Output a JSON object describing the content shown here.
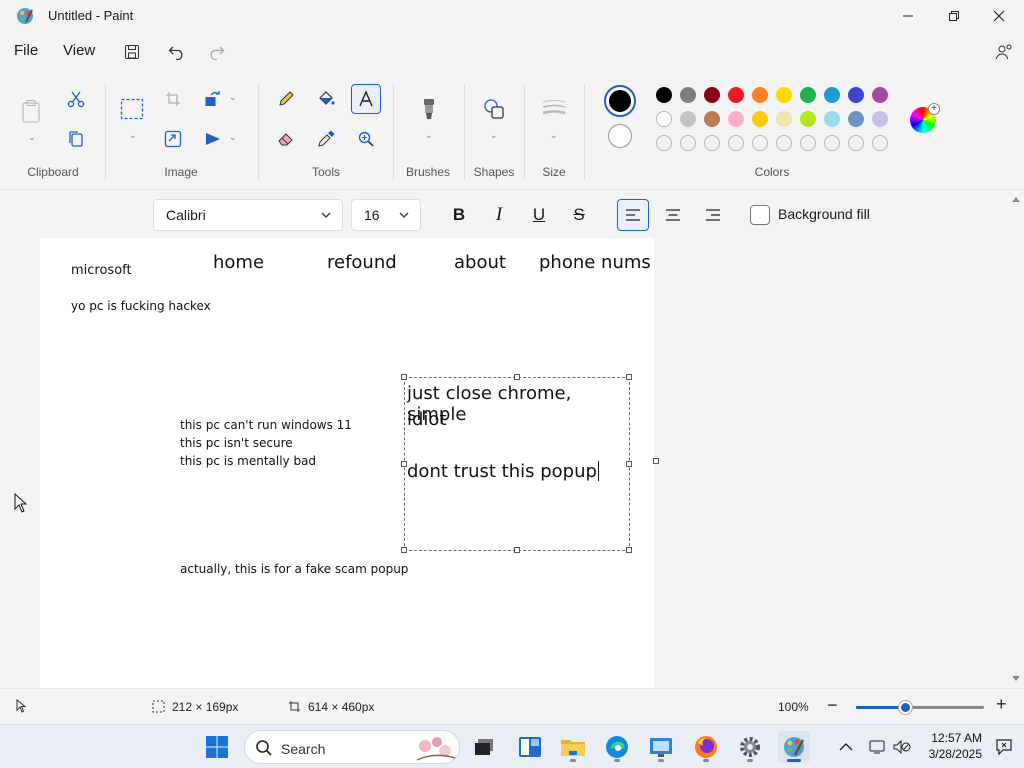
{
  "window": {
    "title": "Untitled - Paint"
  },
  "menu": {
    "file": "File",
    "view": "View"
  },
  "ribbon": {
    "groups": {
      "clipboard": "Clipboard",
      "image": "Image",
      "tools": "Tools",
      "brushes": "Brushes",
      "shapes": "Shapes",
      "size": "Size",
      "colors": "Colors"
    },
    "colors": {
      "primary": "#000000",
      "secondary": "#ffffff",
      "row1": [
        "#000000",
        "#7f7f7f",
        "#880015",
        "#ed1c24",
        "#ff7f27",
        "#ffd800",
        "#22b14c",
        "#1d9bd7",
        "#3f48cc",
        "#a349a4"
      ],
      "row2": [
        "#ffffff",
        "#c3c3c3",
        "#b97a57",
        "#ffaec9",
        "#ffc90e",
        "#efe4b0",
        "#b5e61d",
        "#99d9ea",
        "#7092be",
        "#c8bfe7"
      ]
    }
  },
  "text_toolbar": {
    "font": "Calibri",
    "size": "16",
    "background_fill": "Background fill"
  },
  "canvas": {
    "brand": "microsoft",
    "nav": [
      "home",
      "refound",
      "about",
      "phone nums"
    ],
    "warning": "yo pc is fucking hackex",
    "checks": [
      "this pc can't run windows 11",
      "this pc isn't secure",
      "this pc is mentally bad"
    ],
    "footer": "actually, this is for a fake scam popup",
    "textbox_lines": [
      "just close chrome, simple",
      "idiot",
      "dont trust this popup"
    ]
  },
  "status": {
    "selection": "212 × 169px",
    "canvas_size": "614 × 460px",
    "zoom": "100%",
    "zoom_level": 0.38
  },
  "taskbar": {
    "search": "Search",
    "time": "12:57 AM",
    "date": "3/28/2025"
  }
}
